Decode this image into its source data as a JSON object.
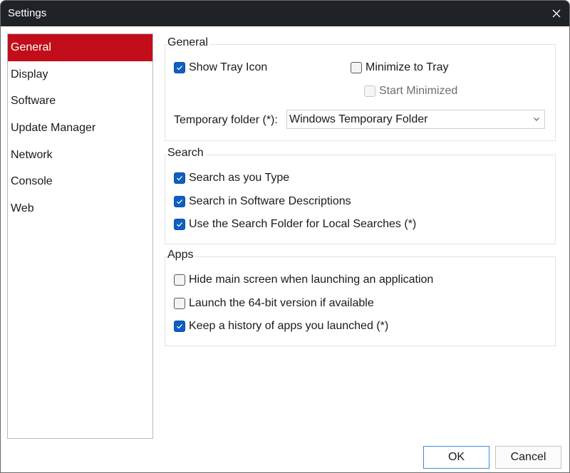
{
  "window": {
    "title": "Settings",
    "close_icon": "close-icon"
  },
  "sidebar": {
    "items": [
      {
        "label": "General",
        "active": true
      },
      {
        "label": "Display",
        "active": false
      },
      {
        "label": "Software",
        "active": false
      },
      {
        "label": "Update Manager",
        "active": false
      },
      {
        "label": "Network",
        "active": false
      },
      {
        "label": "Console",
        "active": false
      },
      {
        "label": "Web",
        "active": false
      }
    ],
    "active_color": "#c20e1a"
  },
  "general": {
    "label": "General",
    "show_tray_icon": {
      "label": "Show Tray Icon",
      "checked": true
    },
    "minimize_to_tray": {
      "label": "Minimize to Tray",
      "checked": false
    },
    "start_minimized": {
      "label": "Start Minimized",
      "checked": false,
      "disabled": true
    },
    "temp_folder": {
      "label": "Temporary folder (*):",
      "value": "Windows Temporary Folder"
    }
  },
  "search": {
    "label": "Search",
    "options": [
      {
        "label": "Search as you Type",
        "checked": true
      },
      {
        "label": "Search in Software Descriptions",
        "checked": true
      },
      {
        "label": "Use the Search Folder for Local Searches (*)",
        "checked": true
      }
    ]
  },
  "apps": {
    "label": "Apps",
    "options": [
      {
        "label": "Hide main screen when launching an application",
        "checked": false
      },
      {
        "label": "Launch the 64-bit version if available",
        "checked": false
      },
      {
        "label": "Keep a history of apps you launched (*)",
        "checked": true
      }
    ]
  },
  "footer": {
    "ok_label": "OK",
    "cancel_label": "Cancel"
  },
  "colors": {
    "checkbox_checked": "#0f5fc2",
    "titlebar": "#1f2226"
  }
}
